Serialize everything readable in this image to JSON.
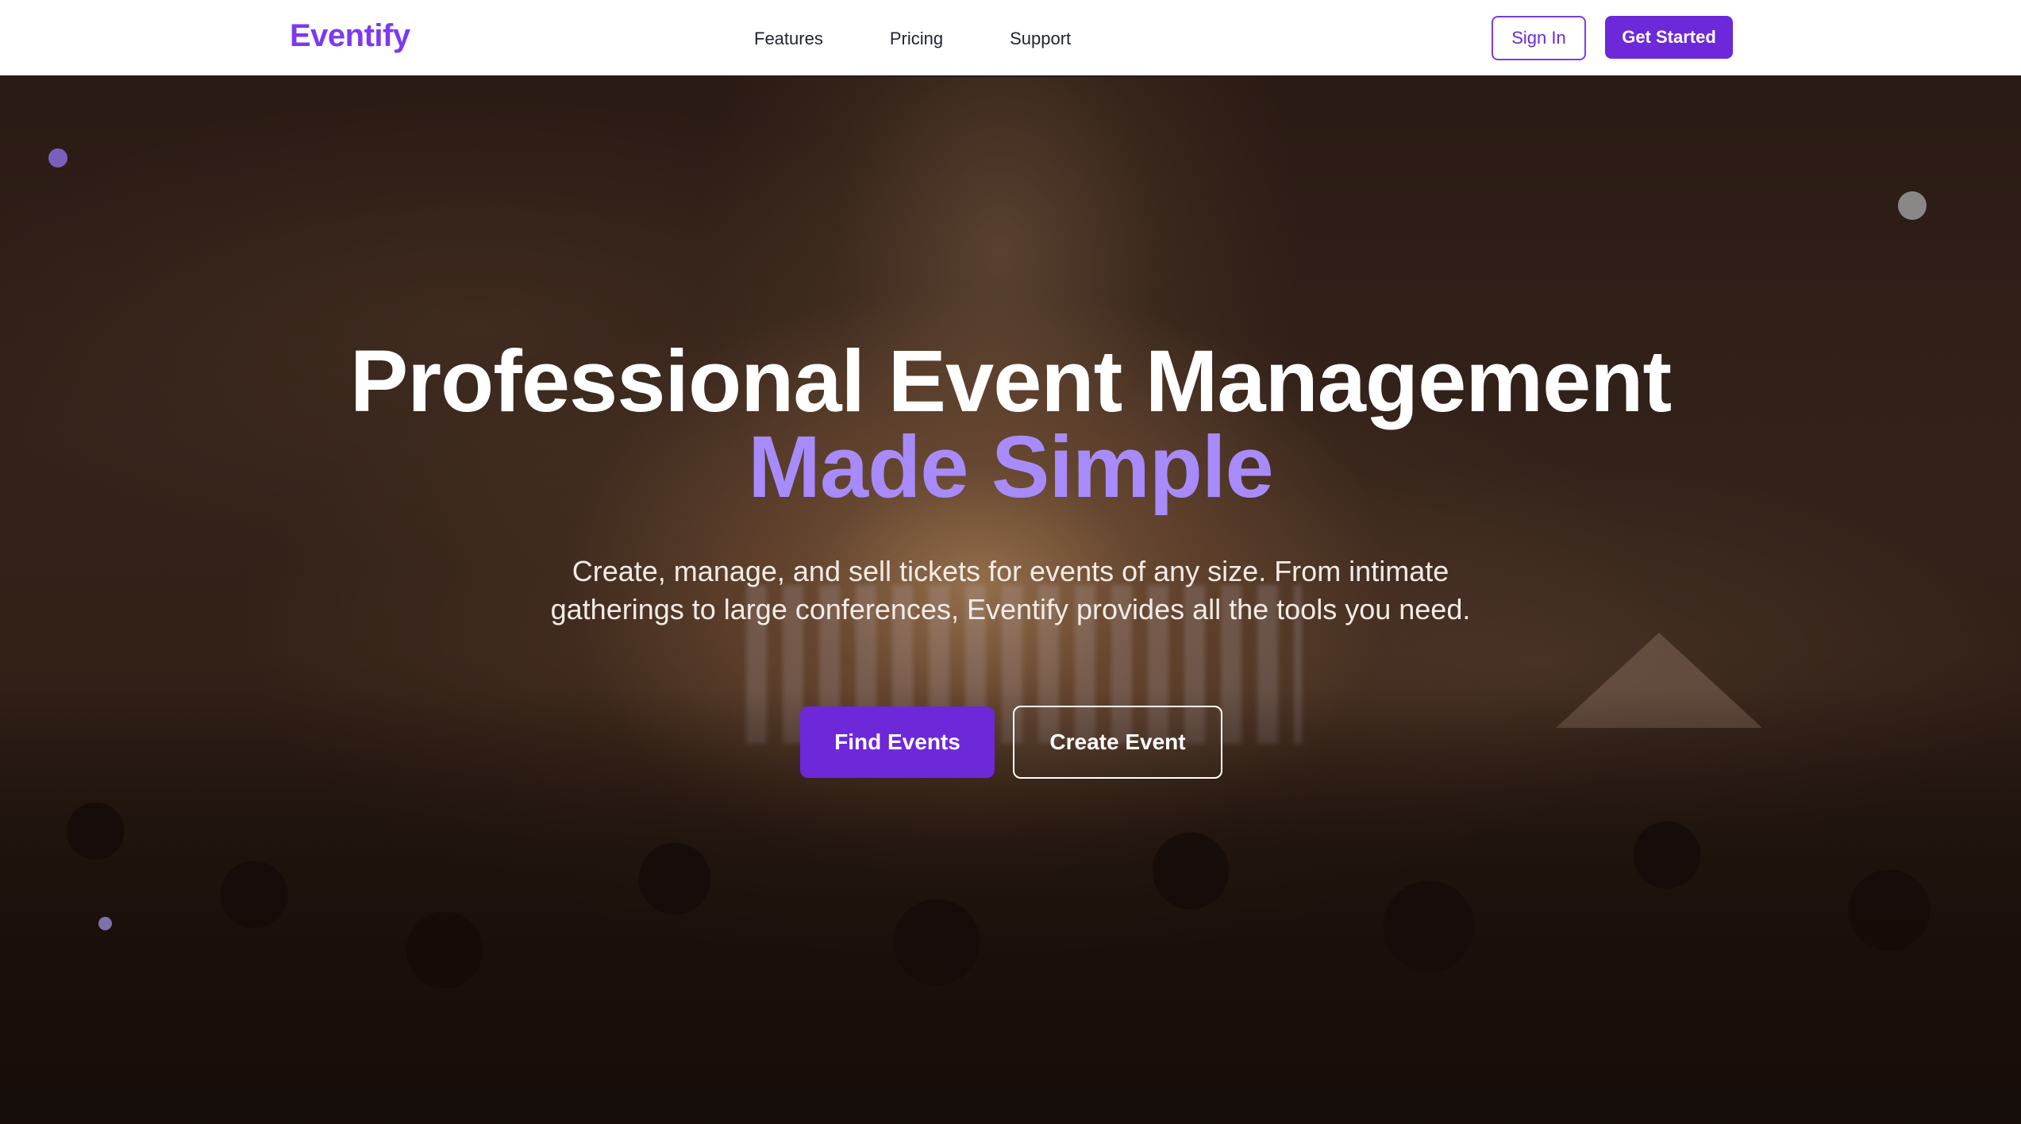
{
  "nav": {
    "logo": "Eventify",
    "links": [
      "Features",
      "Pricing",
      "Support"
    ],
    "sign_in": "Sign In",
    "get_started": "Get Started"
  },
  "hero": {
    "title_line1": "Professional Event Management",
    "title_line2": "Made Simple",
    "subtitle_line1": "Create, manage, and sell tickets for events of any size. From intimate",
    "subtitle_line2": "gatherings to large conferences, Eventify provides all the tools you need.",
    "primary_cta": "Find Events",
    "secondary_cta": "Create Event"
  },
  "colors": {
    "brand": "#6d28d9",
    "accent_text": "#a78bfa",
    "nav_text": "#1f2333"
  }
}
